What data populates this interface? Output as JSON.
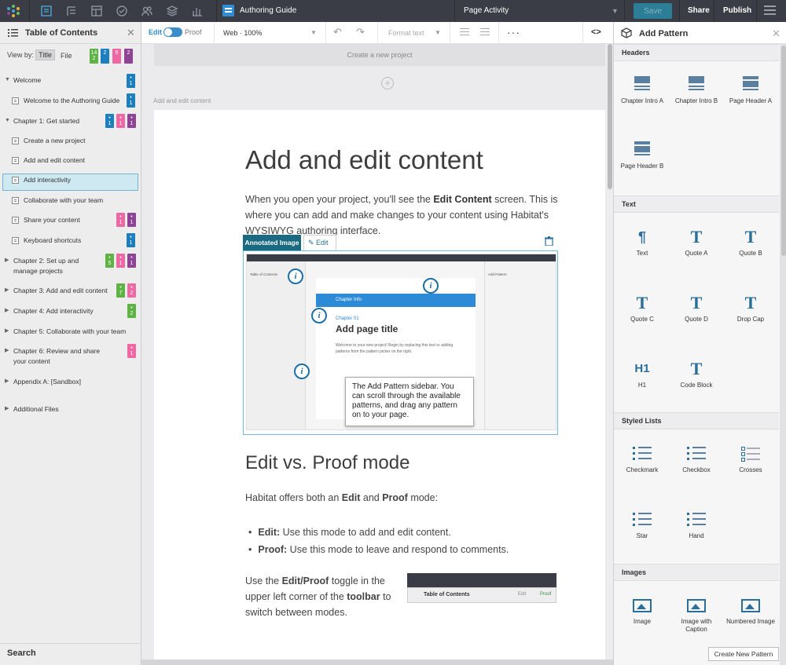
{
  "topbar": {
    "doc_title": "Authoring Guide",
    "page_activity": "Page Activity",
    "save": "Save",
    "share": "Share",
    "publish": "Publish"
  },
  "toc": {
    "title": "Table of Contents",
    "view_by": "View by:",
    "view_title": "Title",
    "view_file": "File",
    "header_badges": [
      "14\n2",
      "2",
      "9",
      "2"
    ],
    "items": [
      {
        "label": "Welcome",
        "badges": [
          "1"
        ]
      },
      {
        "label": "Welcome to the Authoring Guide",
        "badges": [
          "1"
        ]
      },
      {
        "label": "Chapter 1: Get started",
        "badges": [
          "1",
          "1",
          "1"
        ]
      },
      {
        "label": "Create a new project"
      },
      {
        "label": "Add and edit content"
      },
      {
        "label": "Add interactivity"
      },
      {
        "label": "Collaborate with your team"
      },
      {
        "label": "Share your content",
        "badges": [
          "1",
          "1"
        ]
      },
      {
        "label": "Keyboard shortcuts",
        "badges": [
          "1"
        ]
      },
      {
        "label": "Chapter 2: Set up and manage projects",
        "badges": [
          "5",
          "1"
        ]
      },
      {
        "label": "Chapter 3: Add and edit content",
        "badges": [
          "7",
          "2"
        ]
      },
      {
        "label": "Chapter 4: Add interactivity",
        "badges": [
          "2"
        ]
      },
      {
        "label": "Chapter 5: Collaborate with your team"
      },
      {
        "label": "Chapter 6: Review and share your content",
        "badges": [
          "1"
        ]
      },
      {
        "label": "Appendix A: [Sandbox]"
      },
      {
        "label": "Additional Files"
      }
    ],
    "search": "Search"
  },
  "toolbar": {
    "edit": "Edit",
    "proof": "Proof",
    "view_mode": "Web · 100%",
    "format_text": "Format text",
    "more": "···",
    "code": "<>"
  },
  "canvas": {
    "create_project": "Create a new project",
    "breadcrumb": "Add and edit content",
    "heading": "Add and edit content",
    "intro_1": "When you open your project, you'll see the ",
    "intro_bold": "Edit Content",
    "intro_2": " screen. This is where you can add and make changes to your content using Habitat's WYSIWYG authoring interface.",
    "annotated_tag": "Annotated Image",
    "annotated_edit": "Edit",
    "mini": {
      "toc_title": "Table of Contents",
      "chapter_info": "Chapter Info",
      "chapter": "Chapter 01",
      "title": "Add page title",
      "welcome": "Welcome to your new project! Begin by replacing this text or adding patterns from the pattern picker on the right.",
      "add_pattern": "Add Pattern",
      "sample_page": "Sample Page",
      "search": "Search"
    },
    "callout": "The Add Pattern sidebar. You can scroll through the available patterns, and drag any pattern on to your page.",
    "heading2": "Edit vs. Proof mode",
    "p2_1": "Habitat offers both an ",
    "p2_edit": "Edit",
    "p2_and": " and ",
    "p2_proof": "Proof",
    "p2_mode": " mode:",
    "bullet1_b": "Edit:",
    "bullet1": " Use this mode to add and edit content.",
    "bullet2_b": "Proof:",
    "bullet2": " Use this mode to leave and respond to comments.",
    "p3_1": "Use the ",
    "p3_b1": "Edit/Proof",
    "p3_2": " toggle in the upper left corner of the ",
    "p3_b2": "toolbar",
    "p3_3": " to switch between modes.",
    "mini2_toc": "Table of Contents",
    "mini2_edit": "Edit",
    "mini2_proof": "Proof"
  },
  "pattern": {
    "title": "Add Pattern",
    "sections": {
      "headers": "Headers",
      "text": "Text",
      "styled_lists": "Styled Lists",
      "images": "Images"
    },
    "headers": [
      "Chapter Intro A",
      "Chapter Intro B",
      "Page Header A",
      "Page Header B"
    ],
    "text": [
      "Text",
      "Quote A",
      "Quote B",
      "Quote C",
      "Quote D",
      "Drop Cap",
      "H1",
      "Code Block"
    ],
    "lists": [
      "Checkmark",
      "Checkbox",
      "Crosses",
      "Star",
      "Hand"
    ],
    "images": [
      "Image",
      "Image with Caption",
      "Numbered Image"
    ],
    "glyph_T": "T",
    "glyph_H1": "H1",
    "glyph_para": "¶",
    "create_button": "Create New Pattern"
  }
}
